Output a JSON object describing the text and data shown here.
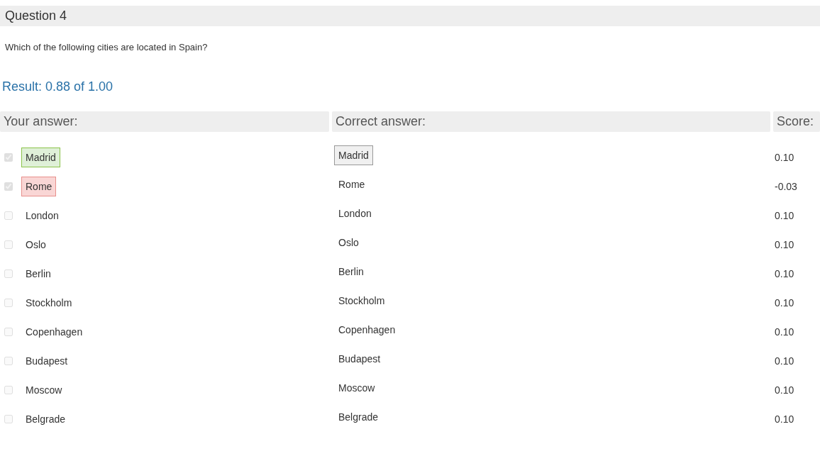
{
  "question": {
    "title": "Question 4",
    "prompt": "Which of the following cities are located in Spain?",
    "result": "Result: 0.88 of 1.00"
  },
  "columns": [
    "Your answer:",
    "Correct answer:",
    "Score:"
  ],
  "rows": [
    {
      "answer": "Madrid",
      "checked": true,
      "graded_correct": true,
      "graded_incorrect": false,
      "correct_answer": "Madrid",
      "expected": true,
      "score": "0.10"
    },
    {
      "answer": "Rome",
      "checked": true,
      "graded_correct": false,
      "graded_incorrect": true,
      "correct_answer": "Rome",
      "expected": false,
      "score": "-0.03"
    },
    {
      "answer": "London",
      "checked": false,
      "graded_correct": false,
      "graded_incorrect": false,
      "correct_answer": "London",
      "expected": false,
      "score": "0.10"
    },
    {
      "answer": "Oslo",
      "checked": false,
      "graded_correct": false,
      "graded_incorrect": false,
      "correct_answer": "Oslo",
      "expected": false,
      "score": "0.10"
    },
    {
      "answer": "Berlin",
      "checked": false,
      "graded_correct": false,
      "graded_incorrect": false,
      "correct_answer": "Berlin",
      "expected": false,
      "score": "0.10"
    },
    {
      "answer": "Stockholm",
      "checked": false,
      "graded_correct": false,
      "graded_incorrect": false,
      "correct_answer": "Stockholm",
      "expected": false,
      "score": "0.10"
    },
    {
      "answer": "Copenhagen",
      "checked": false,
      "graded_correct": false,
      "graded_incorrect": false,
      "correct_answer": "Copenhagen",
      "expected": false,
      "score": "0.10"
    },
    {
      "answer": "Budapest",
      "checked": false,
      "graded_correct": false,
      "graded_incorrect": false,
      "correct_answer": "Budapest",
      "expected": false,
      "score": "0.10"
    },
    {
      "answer": "Moscow",
      "checked": false,
      "graded_correct": false,
      "graded_incorrect": false,
      "correct_answer": "Moscow",
      "expected": false,
      "score": "0.10"
    },
    {
      "answer": "Belgrade",
      "checked": false,
      "graded_correct": false,
      "graded_incorrect": false,
      "correct_answer": "Belgrade",
      "expected": false,
      "score": "0.10"
    }
  ]
}
